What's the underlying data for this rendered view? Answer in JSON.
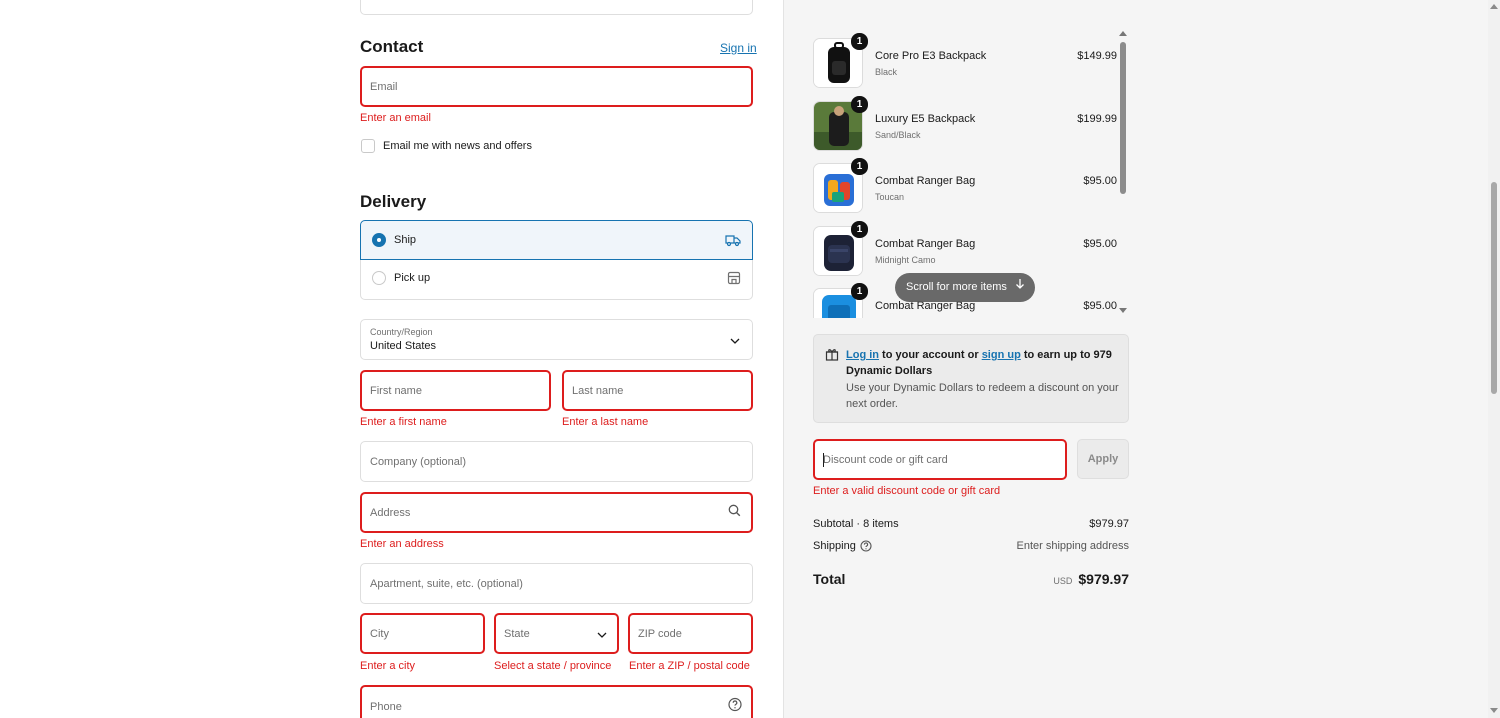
{
  "contact": {
    "heading": "Contact",
    "sign_in": "Sign in",
    "email_placeholder": "Email",
    "email_error": "Enter an email",
    "newsletter_label": "Email me with news and offers"
  },
  "delivery": {
    "heading": "Delivery",
    "options": [
      {
        "label": "Ship",
        "selected": true,
        "icon": "truck-icon"
      },
      {
        "label": "Pick up",
        "selected": false,
        "icon": "store-icon"
      }
    ],
    "country_label": "Country/Region",
    "country_value": "United States",
    "first_name": "First name",
    "first_name_error": "Enter a first name",
    "last_name": "Last name",
    "last_name_error": "Enter a last name",
    "company": "Company (optional)",
    "address": "Address",
    "address_error": "Enter an address",
    "apartment": "Apartment, suite, etc. (optional)",
    "city": "City",
    "city_error": "Enter a city",
    "state": "State",
    "state_error": "Select a state / province",
    "zip": "ZIP code",
    "zip_error": "Enter a ZIP / postal code",
    "phone": "Phone"
  },
  "cart": {
    "items": [
      {
        "name": "Core Pro E3 Backpack",
        "variant": "Black",
        "price": "$149.99",
        "qty": "1"
      },
      {
        "name": "Luxury E5 Backpack",
        "variant": "Sand/Black",
        "price": "$199.99",
        "qty": "1"
      },
      {
        "name": "Combat Ranger Bag",
        "variant": "Toucan",
        "price": "$95.00",
        "qty": "1"
      },
      {
        "name": "Combat Ranger Bag",
        "variant": "Midnight Camo",
        "price": "$95.00",
        "qty": "1"
      },
      {
        "name": "Combat Ranger Bag",
        "variant": "",
        "price": "$95.00",
        "qty": "1"
      }
    ],
    "scroll_hint": "Scroll for more items"
  },
  "rewards": {
    "log_in": "Log in",
    "text1": " to your account or ",
    "sign_up": "sign up",
    "text2": " to earn up to 979 Dynamic Dollars",
    "subtext": "Use your Dynamic Dollars to redeem a discount on your next order."
  },
  "discount": {
    "placeholder": "Discount code or gift card",
    "apply": "Apply",
    "error": "Enter a valid discount code or gift card"
  },
  "summary": {
    "subtotal_label": "Subtotal · 8 items",
    "subtotal_value": "$979.97",
    "shipping_label": "Shipping",
    "shipping_value": "Enter shipping address",
    "total_label": "Total",
    "currency": "USD",
    "total_value": "$979.97"
  },
  "colors": {
    "error": "#dd1d1d",
    "accent": "#1773b0"
  }
}
